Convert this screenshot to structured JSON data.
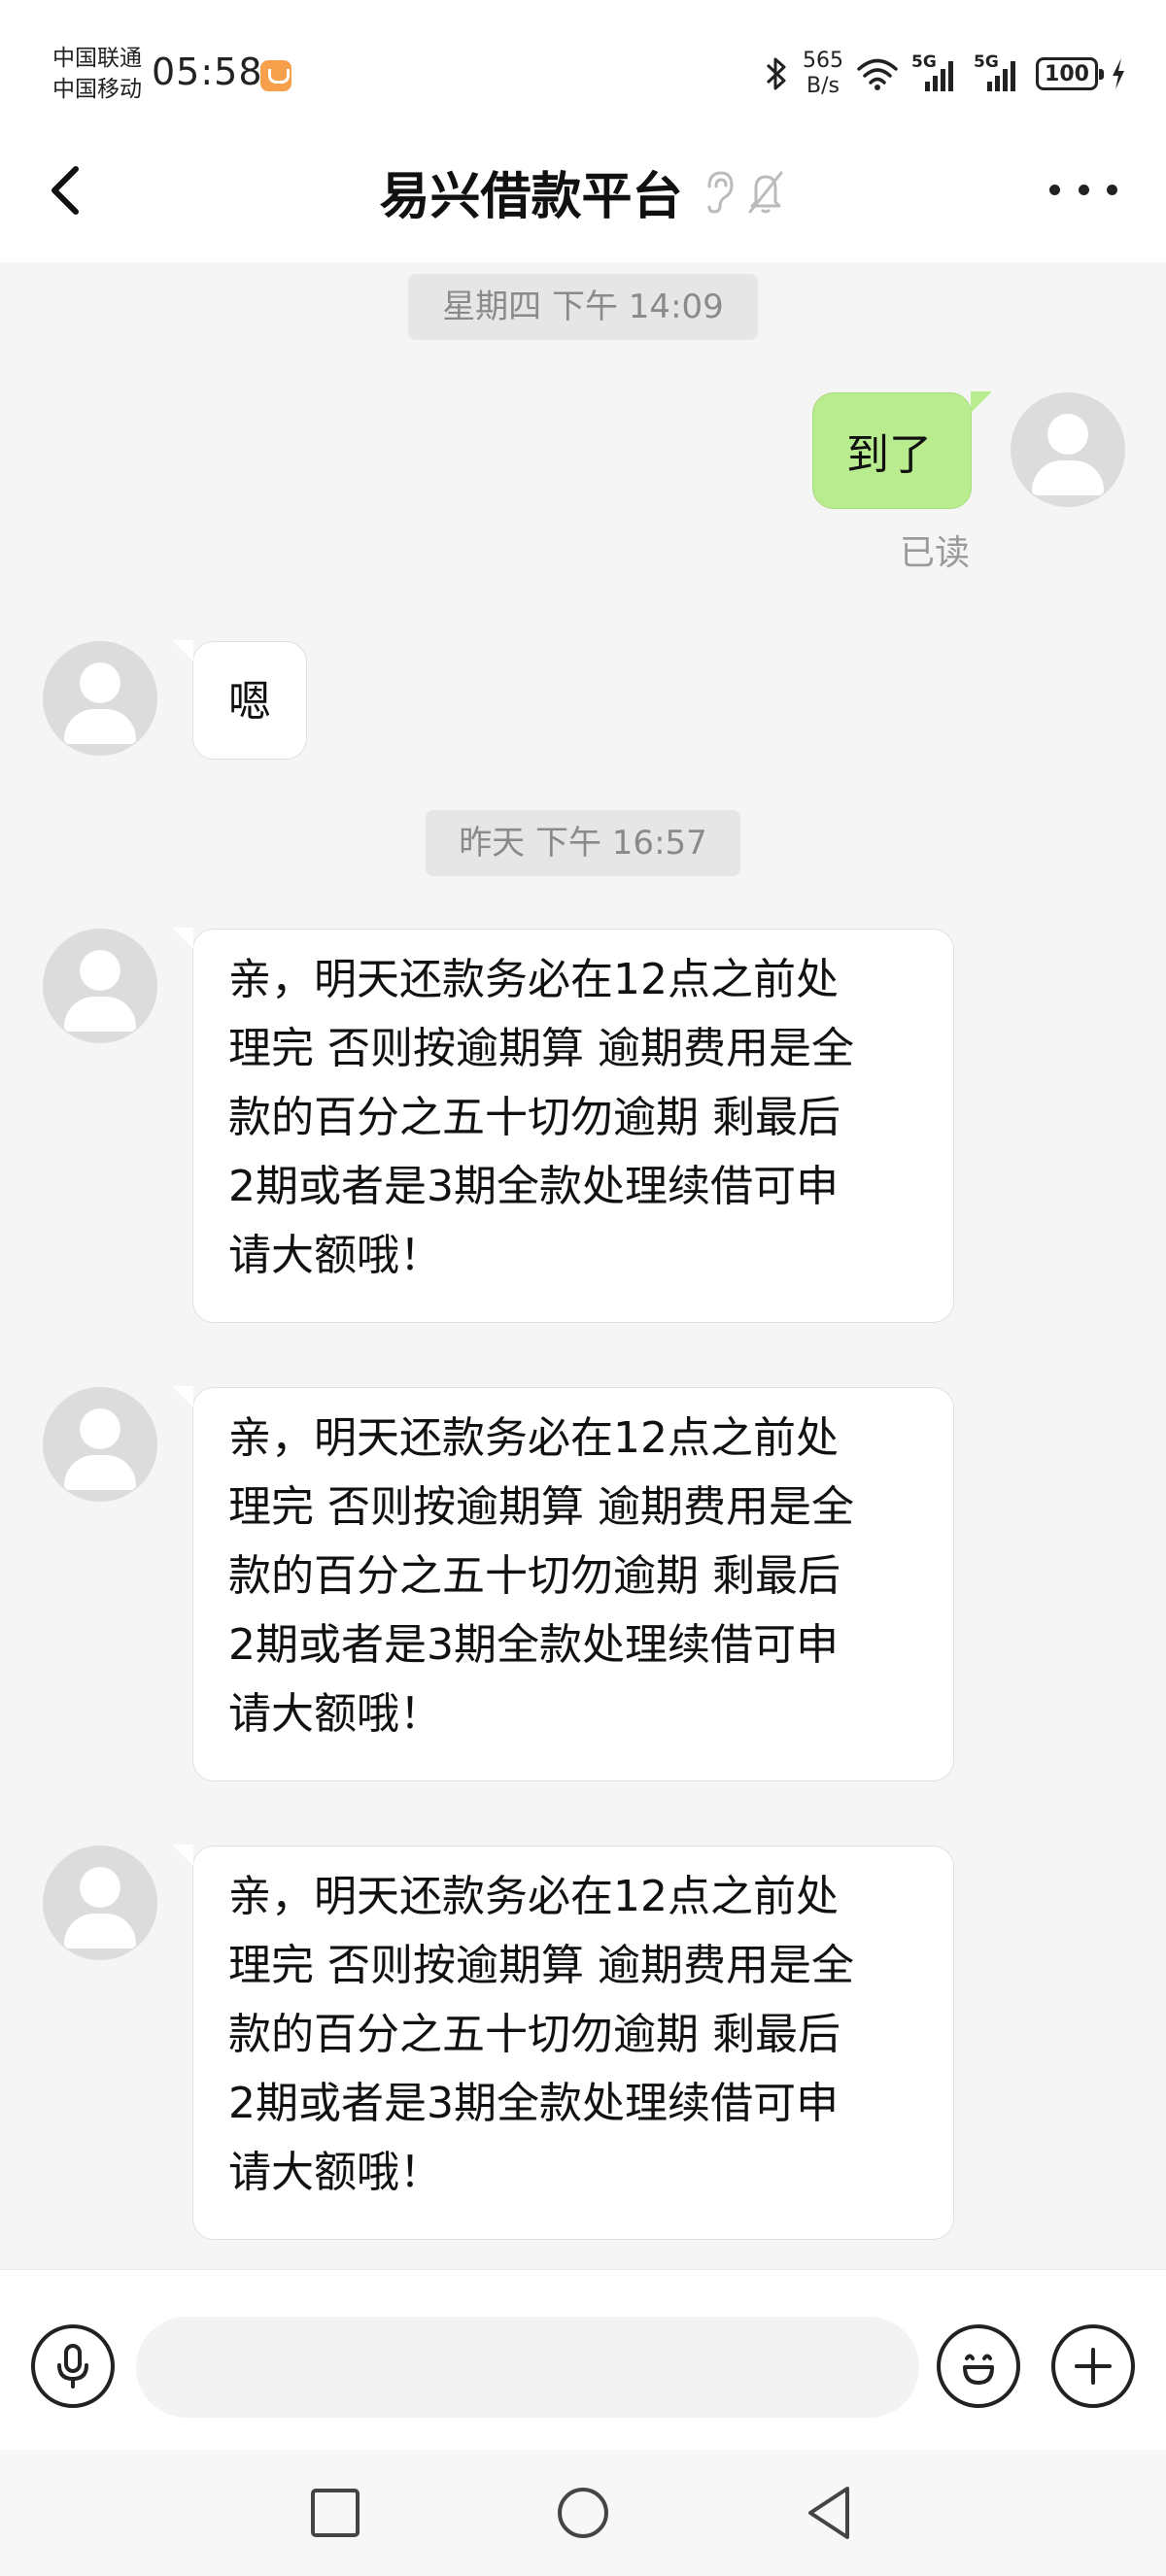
{
  "status_bar": {
    "carrier_1": "中国联通",
    "carrier_2": "中国移动",
    "time": "05:58",
    "net_speed_value": "565",
    "net_speed_unit": "B/s",
    "sim1_network": "5G",
    "sim2_network": "5G",
    "battery": "100"
  },
  "header": {
    "title": "易兴借款平台"
  },
  "messages": {
    "timestamp_1": "星期四 下午 14:09",
    "out_1": "到了",
    "out_1_status": "已读",
    "in_1": "嗯",
    "timestamp_2": "昨天 下午 16:57",
    "in_2": "亲，明天还款务必在12点之前处\n理完 否则按逾期算 逾期费用是全\n款的百分之五十切勿逾期 剩最后\n2期或者是3期全款处理续借可申\n请大额哦！",
    "in_3": "亲，明天还款务必在12点之前处\n理完 否则按逾期算 逾期费用是全\n款的百分之五十切勿逾期 剩最后\n2期或者是3期全款处理续借可申\n请大额哦！",
    "in_4": "亲，明天还款务必在12点之前处\n理完 否则按逾期算 逾期费用是全\n款的百分之五十切勿逾期 剩最后\n2期或者是3期全款处理续借可申\n请大额哦！"
  },
  "input": {
    "value": "",
    "placeholder": ""
  },
  "colors": {
    "outgoing_bubble": "#b8ec8e",
    "incoming_bubble": "#ffffff",
    "background": "#f5f5f5",
    "app_badge": "#f6a04b"
  },
  "icons": [
    "back-arrow-icon",
    "ear-icon",
    "mute-bell-icon",
    "more-icon",
    "microphone-icon",
    "emoji-icon",
    "plus-icon",
    "recent-apps-icon",
    "home-icon",
    "back-triangle-icon",
    "bluetooth-icon",
    "wifi-icon",
    "signal-icon",
    "battery-icon",
    "charging-icon"
  ]
}
